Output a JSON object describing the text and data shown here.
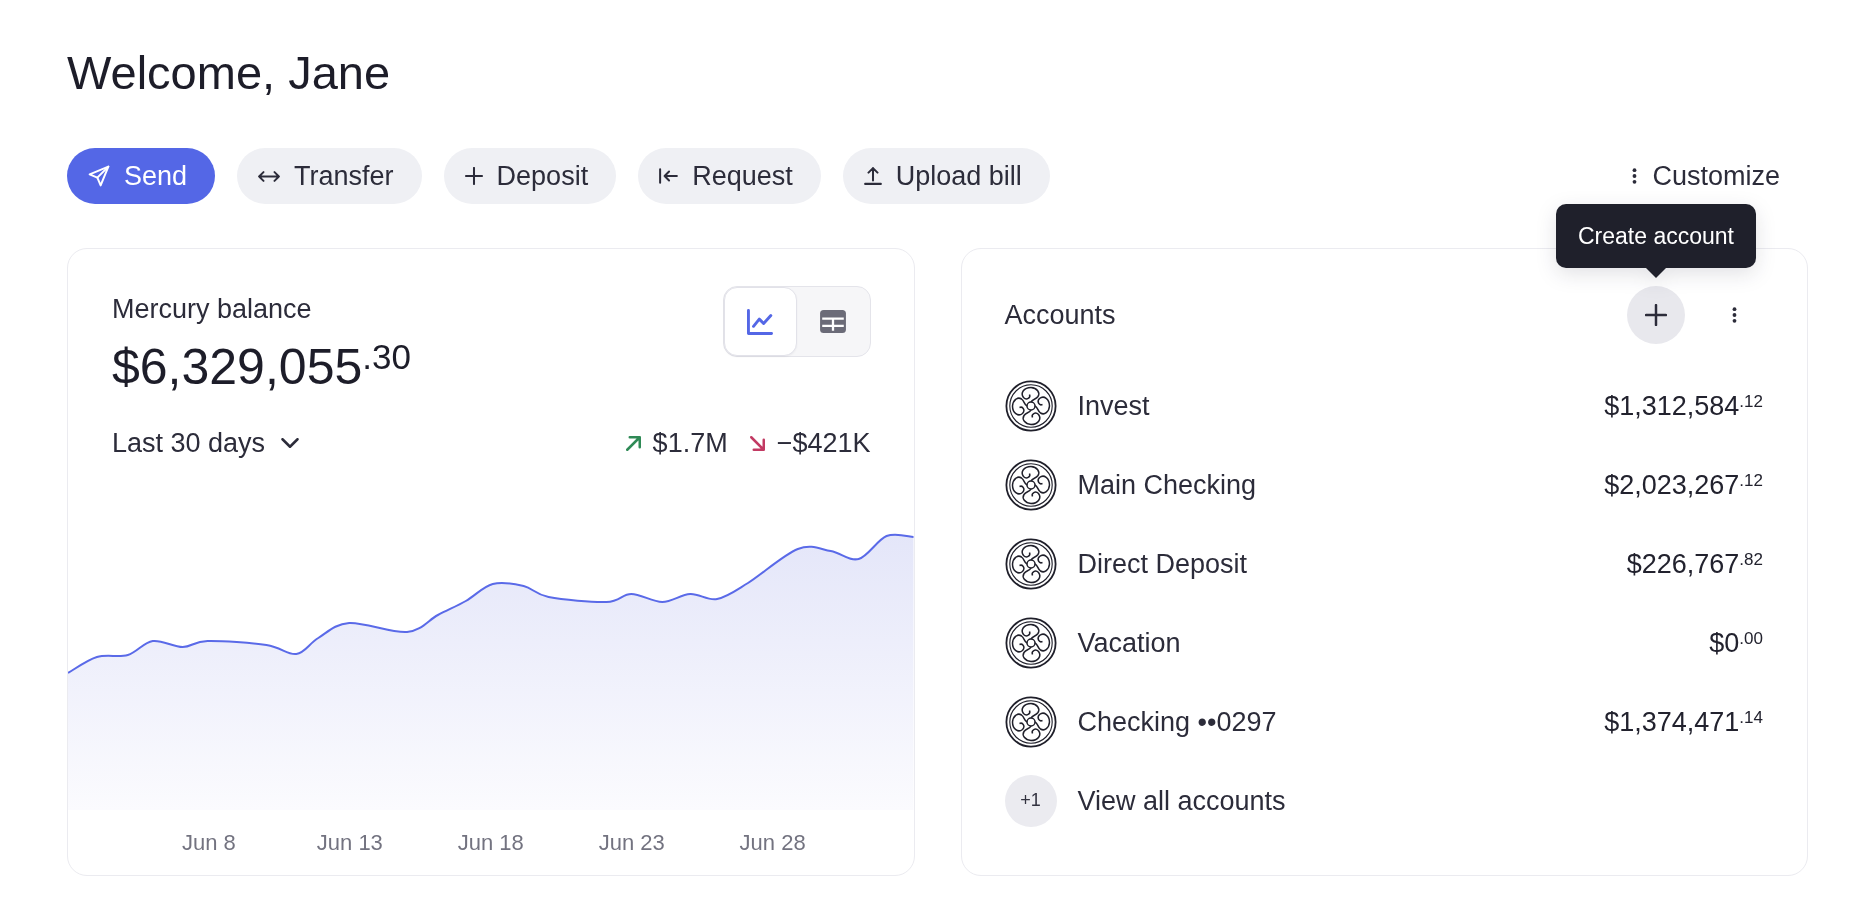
{
  "greeting": {
    "title": "Welcome, Jane"
  },
  "actions": [
    {
      "kind": "send",
      "label": "Send",
      "primary": true
    },
    {
      "kind": "transfer",
      "label": "Transfer",
      "primary": false
    },
    {
      "kind": "deposit",
      "label": "Deposit",
      "primary": false
    },
    {
      "kind": "request",
      "label": "Request",
      "primary": false
    },
    {
      "kind": "upload",
      "label": "Upload bill",
      "primary": false
    }
  ],
  "customize": {
    "label": "Customize"
  },
  "balance_card": {
    "title": "Mercury balance",
    "amount": "$6,329,055",
    "cents": ".30",
    "view_toggle": [
      {
        "kind": "chart",
        "selected": true
      },
      {
        "kind": "table",
        "selected": false
      }
    ],
    "period": "Last 30 days",
    "flows": [
      {
        "kind": "in",
        "amount": "$1.7M"
      },
      {
        "kind": "out",
        "amount": "−$421K"
      }
    ],
    "x_labels": [
      "Jun 8",
      "Jun 13",
      "Jun 18",
      "Jun 23",
      "Jun 28"
    ]
  },
  "accounts_card": {
    "title": "Accounts",
    "add_button": {
      "hovered": true,
      "tooltip": "Create account"
    },
    "accounts": [
      {
        "name": "Invest",
        "amount": "$1,312,584",
        "cents": ".12"
      },
      {
        "name": "Main Checking",
        "amount": "$2,023,267",
        "cents": ".12"
      },
      {
        "name": "Direct Deposit",
        "amount": "$226,767",
        "cents": ".82"
      },
      {
        "name": "Vacation",
        "amount": "$0",
        "cents": ".00"
      },
      {
        "name": "Checking ••0297",
        "amount": "$1,374,471",
        "cents": ".14"
      }
    ],
    "more": {
      "count": "+1",
      "label": "View all accounts"
    }
  }
}
